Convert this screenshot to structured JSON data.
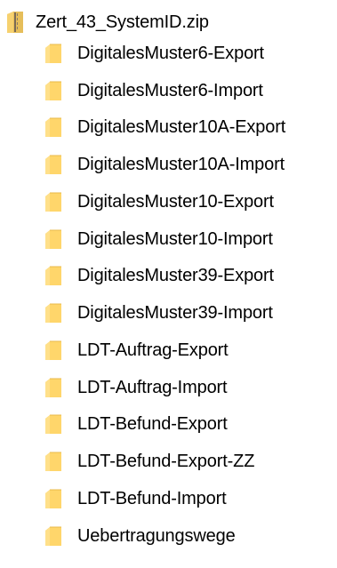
{
  "tree": {
    "root": {
      "label": "Zert_43_SystemID.zip",
      "icon": "zip-folder-icon"
    },
    "children": [
      {
        "label": "DigitalesMuster6-Export",
        "icon": "folder-icon"
      },
      {
        "label": "DigitalesMuster6-Import",
        "icon": "folder-icon"
      },
      {
        "label": "DigitalesMuster10A-Export",
        "icon": "folder-icon"
      },
      {
        "label": "DigitalesMuster10A-Import",
        "icon": "folder-icon"
      },
      {
        "label": "DigitalesMuster10-Export",
        "icon": "folder-icon"
      },
      {
        "label": "DigitalesMuster10-Import",
        "icon": "folder-icon"
      },
      {
        "label": "DigitalesMuster39-Export",
        "icon": "folder-icon"
      },
      {
        "label": "DigitalesMuster39-Import",
        "icon": "folder-icon"
      },
      {
        "label": "LDT-Auftrag-Export",
        "icon": "folder-icon"
      },
      {
        "label": "LDT-Auftrag-Import",
        "icon": "folder-icon"
      },
      {
        "label": "LDT-Befund-Export",
        "icon": "folder-icon"
      },
      {
        "label": "LDT-Befund-Export-ZZ",
        "icon": "folder-icon"
      },
      {
        "label": "LDT-Befund-Import",
        "icon": "folder-icon"
      },
      {
        "label": "Uebertragungswege",
        "icon": "folder-icon"
      }
    ]
  },
  "colors": {
    "folder_body": "#FFD66B",
    "folder_shadow": "#E8B94A",
    "folder_tab": "#F3C858",
    "zip_stripe": "#7A6A55"
  }
}
